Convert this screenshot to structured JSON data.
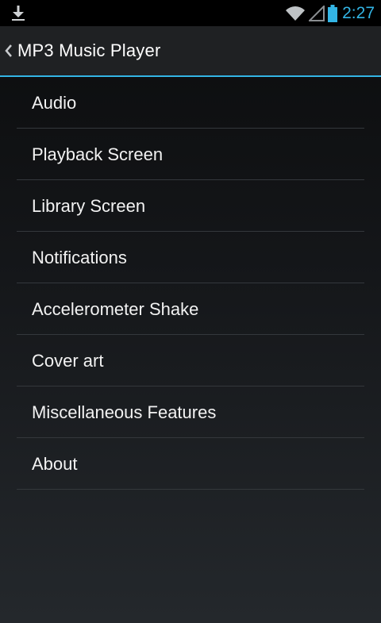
{
  "status_bar": {
    "time": "2:27",
    "accent_color": "#33b5e5",
    "icons": [
      "download-icon",
      "wifi-icon",
      "signal-icon",
      "battery-icon"
    ]
  },
  "action_bar": {
    "title": "MP3 Music Player",
    "up_icon": "chevron-left-icon"
  },
  "menu": {
    "items": [
      {
        "label": "Audio"
      },
      {
        "label": "Playback Screen"
      },
      {
        "label": "Library Screen"
      },
      {
        "label": "Notifications"
      },
      {
        "label": "Accelerometer Shake"
      },
      {
        "label": "Cover art"
      },
      {
        "label": "Miscellaneous Features"
      },
      {
        "label": "About"
      }
    ]
  }
}
